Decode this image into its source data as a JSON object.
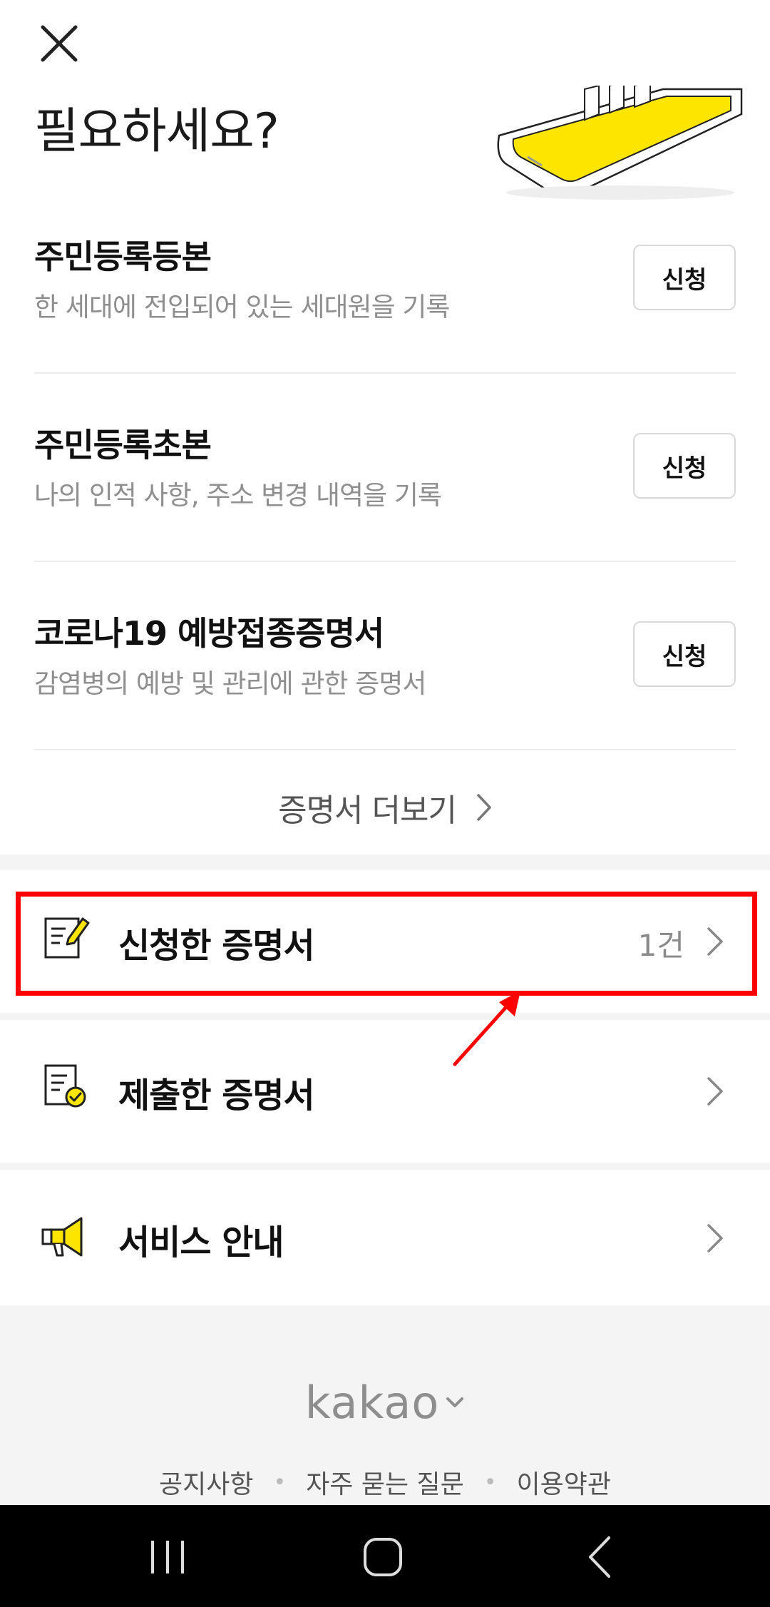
{
  "header": {
    "title": "필요하세요?"
  },
  "certificates": [
    {
      "name": "주민등록등본",
      "desc": "한 세대에 전입되어 있는 세대원을 기록",
      "apply_label": "신청"
    },
    {
      "name": "주민등록초본",
      "desc": "나의 인적 사항, 주소 변경 내역을 기록",
      "apply_label": "신청"
    },
    {
      "name": "코로나19 예방접종증명서",
      "desc": "감염병의 예방 및 관리에 관한 증명서",
      "apply_label": "신청"
    }
  ],
  "more_link": {
    "label": "증명서 더보기"
  },
  "menu": [
    {
      "label": "신청한 증명서",
      "count": "1건",
      "icon": "document-edit-icon"
    },
    {
      "label": "제출한 증명서",
      "icon": "document-check-icon"
    },
    {
      "label": "서비스 안내",
      "icon": "megaphone-icon"
    }
  ],
  "footer": {
    "brand": "kakao",
    "links": [
      "공지사항",
      "자주 묻는 질문",
      "이용약관"
    ]
  },
  "colors": {
    "accent": "#FEE500",
    "highlight": "#FF0000"
  }
}
